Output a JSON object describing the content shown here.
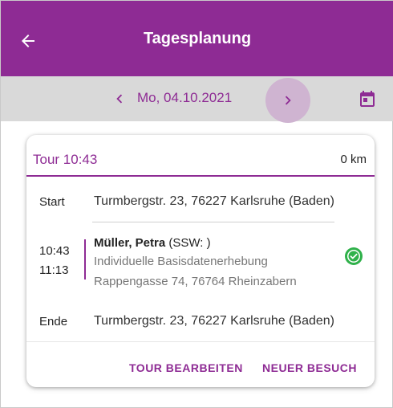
{
  "appbar": {
    "title": "Tagesplanung",
    "back_icon": "arrow-back-icon"
  },
  "datebar": {
    "date": "Mo, 04.10.2021",
    "prev_icon": "chevron-left-icon",
    "next_icon": "chevron-right-icon",
    "calendar_icon": "calendar-icon"
  },
  "tour": {
    "title": "Tour 10:43",
    "distance": "0 km",
    "start_label": "Start",
    "start_address": "Turmbergstr. 23, 76227 Karlsruhe (Baden)",
    "visit": {
      "time_start": "10:43",
      "time_end": "11:13",
      "patient_name": "Müller, Petra",
      "patient_extra": " (SSW: )",
      "type": "Individuelle Basisdatenerhebung",
      "address": "Rappengasse 74, 76764 Rheinzabern",
      "status_icon": "check-circle-icon"
    },
    "end_label": "Ende",
    "end_address": "Turmbergstr. 23, 76227 Karlsruhe (Baden)",
    "actions": {
      "edit": "TOUR BEARBEITEN",
      "new_visit": "NEUER BESUCH"
    }
  },
  "colors": {
    "primary": "#8e2b94",
    "datebar": "#d9d9d9",
    "success": "#2fb14a"
  }
}
